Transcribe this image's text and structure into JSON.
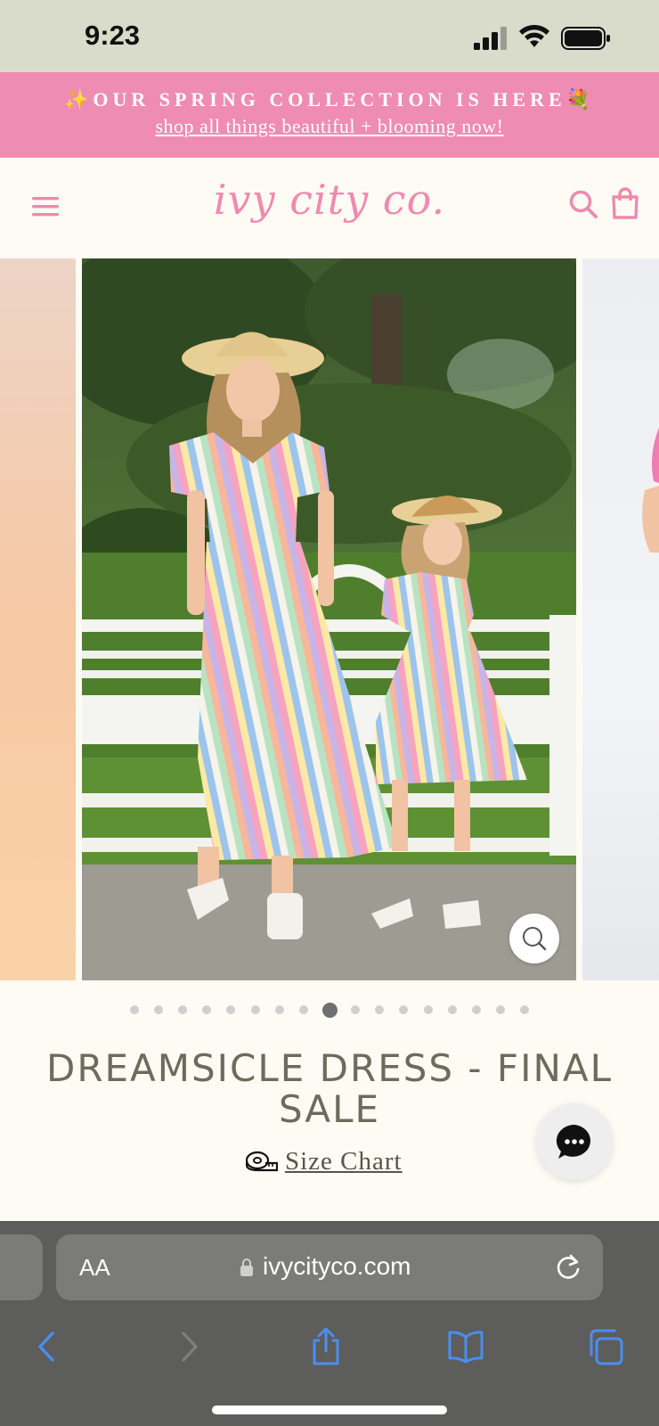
{
  "status_bar": {
    "time": "9:23"
  },
  "promo": {
    "headline": "✨OUR SPRING COLLECTION IS HERE💐",
    "link": "shop all things beautiful + blooming now!"
  },
  "header": {
    "logo": "ivy city co.",
    "icons": [
      "menu-icon",
      "search-icon",
      "bag-icon"
    ]
  },
  "gallery": {
    "slide_count": 17,
    "active_index": 8,
    "zoom_icon": "zoom-icon"
  },
  "product": {
    "title": "DREAMSICLE DRESS - FINAL SALE",
    "size_chart_label": "Size Chart"
  },
  "browser": {
    "aa_label": "AA",
    "url": "ivycityco.com",
    "toolbar_icons": [
      "back-icon",
      "forward-icon",
      "share-icon",
      "bookmarks-icon",
      "tabs-icon"
    ]
  },
  "colors": {
    "status_bg": "#d9dcca",
    "promo_bg": "#ef8cb3",
    "brand_pink": "#f08ab0",
    "page_bg": "#fdfbf4",
    "title_color": "#6e6b5c",
    "browser_bg": "#5d5d5b",
    "safari_blue": "#4a8ef0"
  }
}
